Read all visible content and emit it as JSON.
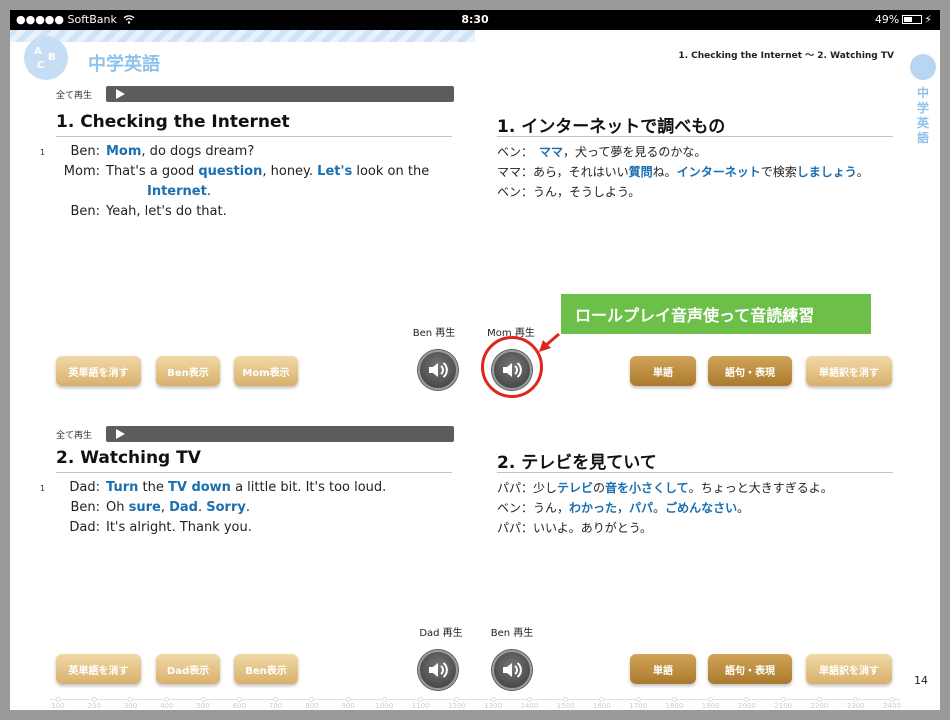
{
  "status_bar": {
    "carrier": "●●●●● SoftBank",
    "wifi_icon": "wifi-icon",
    "time": "8:30",
    "battery": "49%"
  },
  "header": {
    "subject": "中学英語",
    "chapter": "1. Checking the Internet ～ 2. Watching TV",
    "side_tab": "中学英語",
    "circle_letters": [
      "A",
      "B",
      "C"
    ]
  },
  "section1": {
    "play_all_label": "全て再生",
    "title_en": "1. Checking the Internet",
    "title_ja": "1. インターネットで調べもの",
    "line_number": "1",
    "dialogue_en": [
      {
        "speaker": "Ben:",
        "parts": [
          {
            "t": "Mom",
            "b": true
          },
          {
            "t": ", do dogs dream?"
          }
        ]
      },
      {
        "speaker": "Mom:",
        "parts": [
          {
            "t": "That's a good "
          },
          {
            "t": "question",
            "b": true
          },
          {
            "t": ", honey.  "
          },
          {
            "t": "Let's",
            "b": true
          },
          {
            "t": " look on the"
          }
        ]
      },
      {
        "speaker": "",
        "parts": [
          {
            "t": "Internet",
            "b": true
          },
          {
            "t": "."
          }
        ]
      },
      {
        "speaker": "Ben:",
        "parts": [
          {
            "t": "Yeah, let's do that."
          }
        ]
      }
    ],
    "dialogue_ja": [
      {
        "parts": [
          {
            "t": "ベン：　"
          },
          {
            "t": "ママ",
            "b": true
          },
          {
            "t": "，犬って夢を見るのかな。"
          }
        ]
      },
      {
        "parts": [
          {
            "t": "ママ：あら，それはいい"
          },
          {
            "t": "質問",
            "b": true
          },
          {
            "t": "ね。"
          },
          {
            "t": "インターネット",
            "b": true
          },
          {
            "t": "で検索"
          },
          {
            "t": "しましょう",
            "b": true
          },
          {
            "t": "。"
          }
        ]
      },
      {
        "parts": [
          {
            "t": "ベン：うん，そうしよう。"
          }
        ]
      }
    ],
    "buttons_left": [
      "英単語を消す",
      "Ben表示",
      "Mom表示"
    ],
    "speaker_labels": [
      "Ben 再生",
      "Mom 再生"
    ],
    "buttons_right": [
      "単語",
      "語句・表現",
      "単語訳を消す"
    ]
  },
  "callout": "ロールプレイ音声使って音読練習",
  "section2": {
    "play_all_label": "全て再生",
    "title_en": "2. Watching TV",
    "title_ja": "2. テレビを見ていて",
    "line_number": "1",
    "dialogue_en": [
      {
        "speaker": "Dad:",
        "parts": [
          {
            "t": "Turn",
            "b": true
          },
          {
            "t": " the "
          },
          {
            "t": "TV down",
            "b": true
          },
          {
            "t": " a little bit.  It's too loud."
          }
        ]
      },
      {
        "speaker": "Ben:",
        "parts": [
          {
            "t": "Oh "
          },
          {
            "t": "sure",
            "b": true
          },
          {
            "t": ", "
          },
          {
            "t": "Dad",
            "b": true
          },
          {
            "t": ".  "
          },
          {
            "t": "Sorry",
            "b": true
          },
          {
            "t": "."
          }
        ]
      },
      {
        "speaker": "Dad:",
        "parts": [
          {
            "t": "It's alright.  Thank you."
          }
        ]
      }
    ],
    "dialogue_ja": [
      {
        "parts": [
          {
            "t": "パパ：少し"
          },
          {
            "t": "テレビ",
            "b": true
          },
          {
            "t": "の"
          },
          {
            "t": "音を小さくして",
            "b": true
          },
          {
            "t": "。ちょっと大きすぎるよ。"
          }
        ]
      },
      {
        "parts": [
          {
            "t": "ベン：うん，"
          },
          {
            "t": "わかった",
            "b": true
          },
          {
            "t": "，"
          },
          {
            "t": "パパ",
            "b": true
          },
          {
            "t": "。"
          },
          {
            "t": "ごめんなさい",
            "b": true
          },
          {
            "t": "。"
          }
        ]
      },
      {
        "parts": [
          {
            "t": "パパ：いいよ。ありがとう。"
          }
        ]
      }
    ],
    "buttons_left": [
      "英単語を消す",
      "Dad表示",
      "Ben表示"
    ],
    "speaker_labels": [
      "Dad 再生",
      "Ben 再生"
    ],
    "buttons_right": [
      "単語",
      "語句・表現",
      "単語訳を消す"
    ]
  },
  "page_number": "14",
  "ruler_ticks": [
    "100",
    "200",
    "300",
    "400",
    "500",
    "600",
    "700",
    "800",
    "900",
    "1000",
    "1100",
    "1200",
    "1300",
    "1400",
    "1500",
    "1600",
    "1700",
    "1800",
    "1900",
    "2000",
    "2100",
    "2200",
    "2300",
    "2400"
  ],
  "colors": {
    "accent_blue": "#1a6fb1",
    "header_blue": "#8fc3ec",
    "callout_green": "#6cc04a",
    "highlight_red": "#e0251f",
    "button_gold": "#c8984b"
  }
}
